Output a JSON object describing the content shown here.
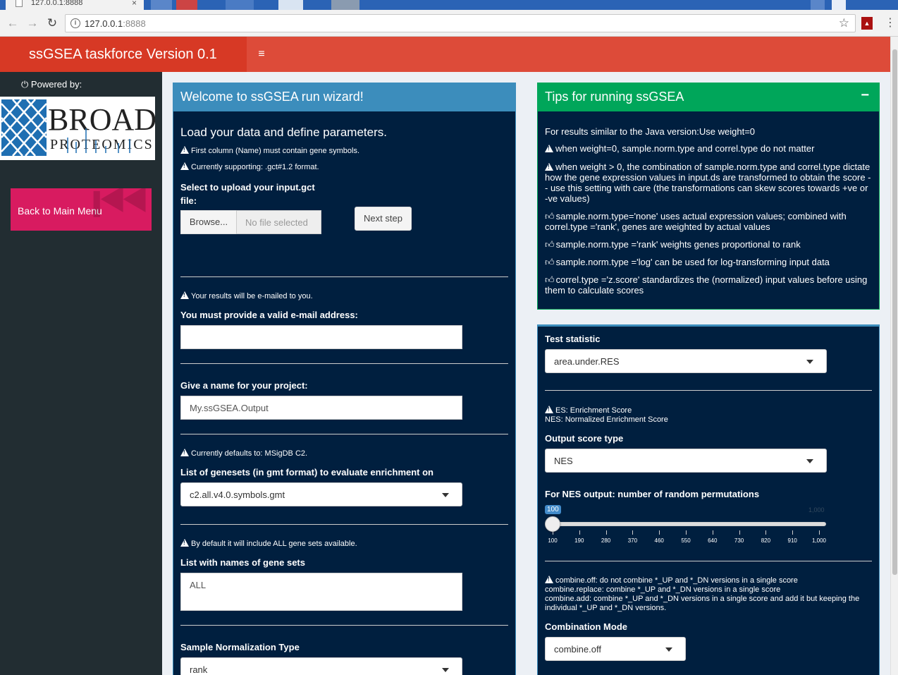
{
  "browser": {
    "tab_title": "127.0.0.1:8888",
    "tab_close": "×",
    "url_host": "127.0.0.1",
    "url_port": ":8888"
  },
  "header": {
    "title": "ssGSEA taskforce Version 0.1",
    "menu_icon": "≡",
    "color": "#dd4b39"
  },
  "sidebar": {
    "powered_by": "Powered by:",
    "logo_text_top": "BROAD",
    "logo_text_bottom": "PROTEOMICS",
    "back_button": "Back to Main Menu"
  },
  "wizard": {
    "title": "Welcome to ssGSEA run wizard!",
    "subtitle": "Load your data and define parameters.",
    "note_first_column": "First column (Name) must contain gene symbols.",
    "note_format": "Currently supporting: .gct#1.2 format.",
    "upload_label_line1": "Select to upload your input.gct",
    "upload_label_line2": "file:",
    "browse_button": "Browse...",
    "file_placeholder": "No file selected",
    "next_button": "Next step",
    "note_email": "Your results will be e-mailed to you.",
    "email_label": "You must provide a valid e-mail address:",
    "email_value": "",
    "project_label": "Give a name for your project:",
    "project_value": "My.ssGSEA.Output",
    "note_defaults": "Currently defaults to: MSigDB C2.",
    "genesets_label": "List of genesets (in gmt format) to evaluate enrichment on",
    "genesets_value": "c2.all.v4.0.symbols.gmt",
    "note_all": "By default it will include ALL gene sets available.",
    "names_label": "List with names of gene sets",
    "names_value": "ALL",
    "norm_label": "Sample Normalization Type",
    "norm_value": "rank"
  },
  "tips": {
    "title": "Tips for running ssGSEA",
    "collapse": "−",
    "line1": "For results similar to the Java version:Use weight=0",
    "line2": "when weight=0, sample.norm.type and correl.type do not matter",
    "line3": "when weight > 0, the combination of sample.norm.type and correl.type dictate how the gene expression values in input.ds are transformed to obtain the score -- use this setting with care (the transformations can skew scores towards +ve or -ve values)",
    "line4": "sample.norm.type='none' uses actual expression values; combined with correl.type ='rank', genes are weighted by actual values",
    "line5": "sample.norm.type ='rank' weights genes proportional to rank",
    "line6": "sample.norm.type ='log' can be used for log-transforming input data",
    "line7": "correl.type ='z.score' standardizes the (normalized) input values before using them to calculate scores"
  },
  "params": {
    "test_stat_label": "Test statistic",
    "test_stat_value": "area.under.RES",
    "es_note_line1": "ES: Enrichment Score",
    "es_note_line2": "NES: Normalized Enrichment Score",
    "output_label": "Output score type",
    "output_value": "NES",
    "perm_label": "For NES output: number of random permutations",
    "perm_value": "100",
    "perm_max": "1,000",
    "perm_min": 100,
    "perm_max_num": 1000,
    "perm_current": 100,
    "perm_ticks": [
      "100",
      "190",
      "280",
      "370",
      "460",
      "550",
      "640",
      "730",
      "820",
      "910",
      "1,000"
    ],
    "combine_note_line1": "combine.off: do not combine *_UP and *_DN versions in a single score",
    "combine_note_line2": "combine.replace: combine *_UP and *_DN versions in a single score",
    "combine_note_line3": "combine.add: combine *_UP and *_DN versions in a single score and add it but keeping the individual *_UP and *_DN versions.",
    "combine_label": "Combination Mode",
    "combine_value": "combine.off"
  }
}
